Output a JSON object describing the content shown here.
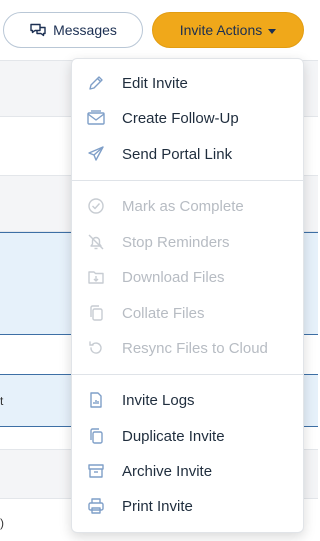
{
  "toolbar": {
    "messages_label": "Messages",
    "invite_actions_label": "Invite Actions"
  },
  "background": {
    "stray_text_1": "t",
    "stray_text_2": ")"
  },
  "menu": {
    "group1": [
      {
        "label": "Edit Invite",
        "icon": "pencil-icon",
        "enabled": true
      },
      {
        "label": "Create Follow-Up",
        "icon": "envelope-icon",
        "enabled": true
      },
      {
        "label": "Send Portal Link",
        "icon": "paper-plane-icon",
        "enabled": true
      }
    ],
    "group2": [
      {
        "label": "Mark as Complete",
        "icon": "check-circle-icon",
        "enabled": false
      },
      {
        "label": "Stop Reminders",
        "icon": "bell-slash-icon",
        "enabled": false
      },
      {
        "label": "Download Files",
        "icon": "folder-download-icon",
        "enabled": false
      },
      {
        "label": "Collate Files",
        "icon": "copy-icon",
        "enabled": false
      },
      {
        "label": "Resync Files to Cloud",
        "icon": "resync-icon",
        "enabled": false
      }
    ],
    "group3": [
      {
        "label": "Invite Logs",
        "icon": "file-chart-icon",
        "enabled": true
      },
      {
        "label": "Duplicate Invite",
        "icon": "duplicate-icon",
        "enabled": true
      },
      {
        "label": "Archive Invite",
        "icon": "archive-icon",
        "enabled": true
      },
      {
        "label": "Print Invite",
        "icon": "printer-icon",
        "enabled": true
      }
    ]
  },
  "colors": {
    "accent": "#f0a81a",
    "icon_enabled": "#7f9fc8",
    "icon_disabled": "#c7ccd2",
    "text": "#1f2d3d"
  }
}
